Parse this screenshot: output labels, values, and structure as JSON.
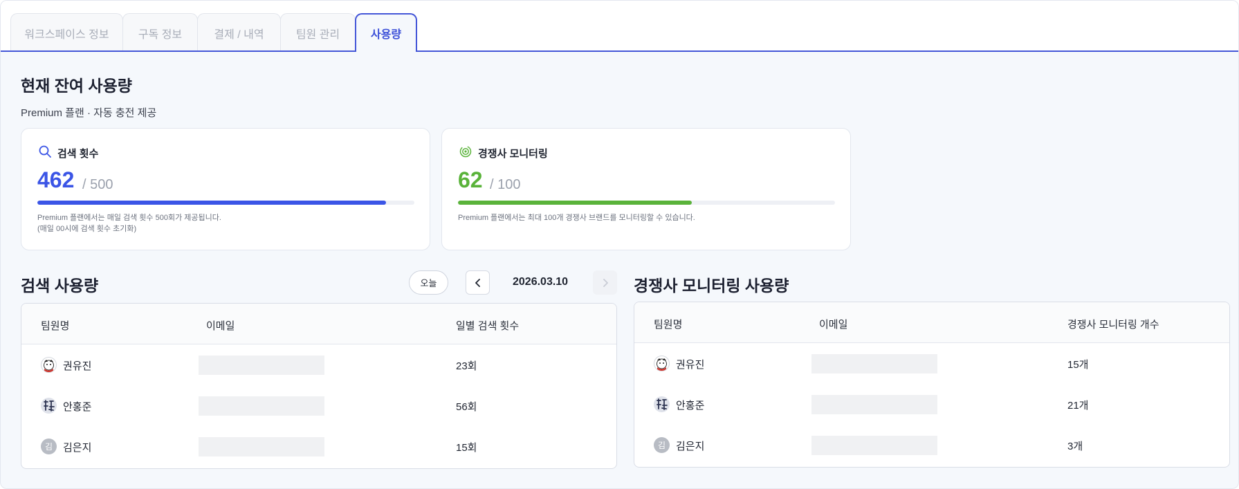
{
  "tabs": [
    {
      "label": "워크스페이스 정보",
      "active": false
    },
    {
      "label": "구독 정보",
      "active": false
    },
    {
      "label": "결제 / 내역",
      "active": false
    },
    {
      "label": "팀원 관리",
      "active": false
    },
    {
      "label": "사용량",
      "active": true
    }
  ],
  "heading": {
    "title": "현재 잔여 사용량",
    "subtitle": "Premium 플랜 · 자동 충전 제공"
  },
  "cards": {
    "search": {
      "icon": "search-icon",
      "title": "검색 횟수",
      "used": "462",
      "total": "/ 500",
      "progress": 0.924,
      "color": "#3b55e6",
      "note_line1": "Premium 플랜에서는 매일 검색 횟수 500회가 제공됩니다.",
      "note_line2": "(매일 00시에 검색 횟수 초기화)"
    },
    "competitor": {
      "icon": "radar-icon",
      "title": "경쟁사 모니터링",
      "used": "62",
      "total": "/ 100",
      "progress": 0.62,
      "color": "#5ab33a",
      "note_line1": "Premium 플랜에서는 최대 100개 경쟁사 브랜드를 모니터링할 수 있습니다."
    }
  },
  "search_usage": {
    "title": "검색 사용량",
    "today_label": "오늘",
    "date": "2026.03.10",
    "columns": [
      "팀원명",
      "이메일",
      "일별 검색 횟수"
    ],
    "rows": [
      {
        "name": "권유진",
        "avatar": "cartoon-avatar",
        "value": "23회"
      },
      {
        "name": "안홍준",
        "avatar": "calligraphy-avatar",
        "value": "56회"
      },
      {
        "name": "김은지",
        "avatar_initial": "김",
        "value": "15회"
      }
    ]
  },
  "competitor_usage": {
    "title": "경쟁사 모니터링 사용량",
    "columns": [
      "팀원명",
      "이메일",
      "경쟁사 모니터링 개수"
    ],
    "rows": [
      {
        "name": "권유진",
        "avatar": "cartoon-avatar",
        "value": "15개"
      },
      {
        "name": "안홍준",
        "avatar": "calligraphy-avatar",
        "value": "21개"
      },
      {
        "name": "김은지",
        "avatar_initial": "김",
        "value": "3개"
      }
    ]
  }
}
